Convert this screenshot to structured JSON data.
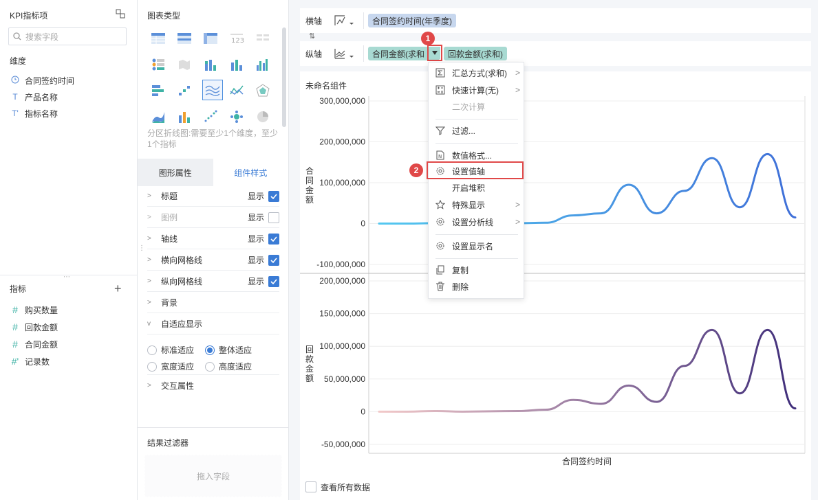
{
  "left": {
    "title": "KPI指标项",
    "search_placeholder": "搜索字段",
    "dimension_title": "维度",
    "dimensions": [
      {
        "icon": "clock-icon",
        "label": "合同签约时间"
      },
      {
        "icon": "text-T-icon",
        "label": "产品名称"
      },
      {
        "icon": "text-T-star-icon",
        "label": "指标名称"
      }
    ],
    "metric_title": "指标",
    "metrics": [
      {
        "icon": "hash-icon",
        "label": "购买数量"
      },
      {
        "icon": "hash-icon",
        "label": "回款金额"
      },
      {
        "icon": "hash-icon",
        "label": "合同金额"
      },
      {
        "icon": "hash-star-icon",
        "label": "记录数"
      }
    ]
  },
  "mid": {
    "title": "图表类型",
    "hint": "分区折线图:需要至少1个维度，至少1个指标",
    "tabs": [
      "图形属性",
      "组件样式"
    ],
    "props": [
      {
        "label": "标题",
        "show": "显示",
        "checked": true,
        "disabled": false
      },
      {
        "label": "图例",
        "show": "显示",
        "checked": false,
        "disabled": true
      },
      {
        "label": "轴线",
        "show": "显示",
        "checked": true,
        "disabled": false
      },
      {
        "label": "横向网格线",
        "show": "显示",
        "checked": true,
        "disabled": false
      },
      {
        "label": "纵向网格线",
        "show": "显示",
        "checked": true,
        "disabled": false
      },
      {
        "label": "背景"
      },
      {
        "label": "自适应显示"
      }
    ],
    "radios": [
      {
        "label": "标准适应",
        "on": false
      },
      {
        "label": "整体适应",
        "on": true
      },
      {
        "label": "宽度适应",
        "on": false
      },
      {
        "label": "高度适应",
        "on": false
      }
    ],
    "interaction": "交互属性",
    "result_filter": "结果过滤器",
    "drop_field": "拖入字段"
  },
  "axes": {
    "x_label": "横轴",
    "x_field": "合同签约时间(年季度)",
    "y_label": "纵轴",
    "y_fields": [
      "合同金额(求和",
      "回款金额(求和)"
    ]
  },
  "chart": {
    "component_title": "未命名组件",
    "view_all": "查看所有数据"
  },
  "menu": {
    "items": [
      {
        "icon": "sigma-icon",
        "label": "汇总方式(求和)",
        "arrow": true,
        "dim": false
      },
      {
        "icon": "calculator-icon",
        "label": "快速计算(无)",
        "arrow": true,
        "dim": false
      },
      {
        "icon": "",
        "label": "二次计算",
        "arrow": false,
        "dim": true
      },
      {
        "icon": "filter-icon",
        "label": "过滤...",
        "arrow": false,
        "dim": false
      },
      {
        "icon": "number-format-icon",
        "label": "数值格式...",
        "arrow": false,
        "dim": false
      },
      {
        "icon": "gear-icon",
        "label": "设置值轴",
        "arrow": false,
        "dim": false
      },
      {
        "icon": "",
        "label": "开启堆积",
        "arrow": false,
        "dim": false
      },
      {
        "icon": "star-icon",
        "label": "特殊显示",
        "arrow": true,
        "dim": false
      },
      {
        "icon": "gear-icon",
        "label": "设置分析线",
        "arrow": true,
        "dim": false
      },
      {
        "icon": "gear-icon",
        "label": "设置显示名",
        "arrow": false,
        "dim": false
      },
      {
        "icon": "copy-icon",
        "label": "复制",
        "arrow": false,
        "dim": false
      },
      {
        "icon": "trash-icon",
        "label": "删除",
        "arrow": false,
        "dim": false
      }
    ]
  },
  "badges": [
    "1",
    "2"
  ],
  "chart_data": [
    {
      "type": "line",
      "ylabel": "合同金额",
      "xlabel": "合同签约时间",
      "yticks": [
        "300,000,000",
        "200,000,000",
        "100,000,000",
        "0",
        "-100,000,000"
      ],
      "ylim": [
        -100000000,
        300000000
      ],
      "values": [
        0,
        0,
        1000000,
        0,
        500000,
        1000000,
        2000000,
        20000000,
        25000000,
        95000000,
        25000000,
        80000000,
        160000000,
        40000000,
        170000000,
        15000000
      ],
      "color_start": "#54c8f0",
      "color_end": "#3f6fd8"
    },
    {
      "type": "line",
      "ylabel": "回款金额",
      "xlabel": "合同签约时间",
      "yticks": [
        "200,000,000",
        "150,000,000",
        "100,000,000",
        "50,000,000",
        "0",
        "-50,000,000"
      ],
      "ylim": [
        -50000000,
        200000000
      ],
      "values": [
        0,
        0,
        1000000,
        0,
        500000,
        1000000,
        3000000,
        18000000,
        12000000,
        40000000,
        15000000,
        70000000,
        125000000,
        28000000,
        125000000,
        5000000
      ],
      "color_start": "#f2c9c9",
      "color_end": "#3f2d7a"
    }
  ]
}
